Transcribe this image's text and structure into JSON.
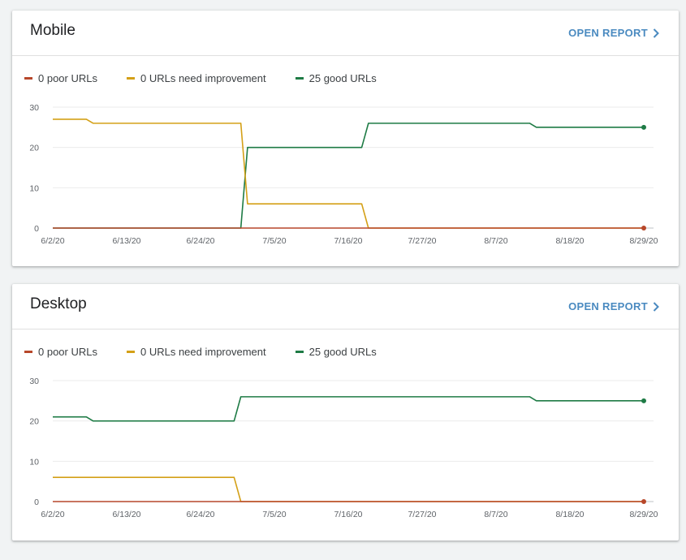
{
  "colors": {
    "poor": "#b7472a",
    "needs_improvement": "#d4a017",
    "good": "#1e7b45",
    "accent": "#4a8ac0"
  },
  "cards": [
    {
      "title": "Mobile",
      "open_report": "OPEN REPORT",
      "legend": [
        "0 poor URLs",
        "0 URLs need improvement",
        "25 good URLs"
      ]
    },
    {
      "title": "Desktop",
      "open_report": "OPEN REPORT",
      "legend": [
        "0 poor URLs",
        "0 URLs need improvement",
        "25 good URLs"
      ]
    }
  ],
  "chart_data": [
    {
      "type": "line",
      "title": "Mobile",
      "xlabel": "",
      "ylabel": "",
      "x_ticks": [
        "6/2/20",
        "6/13/20",
        "6/24/20",
        "7/5/20",
        "7/16/20",
        "7/27/20",
        "8/7/20",
        "8/18/20",
        "8/29/20"
      ],
      "y_ticks": [
        0,
        10,
        20,
        30
      ],
      "xlim": [
        "2020-06-02",
        "2020-08-29"
      ],
      "ylim": [
        0,
        30
      ],
      "grid": true,
      "legend_position": "top-left",
      "series": [
        {
          "name": "0 poor URLs",
          "color": "#b7472a",
          "points": [
            [
              "2020-06-02",
              0
            ],
            [
              "2020-08-29",
              0
            ]
          ]
        },
        {
          "name": "0 URLs need improvement",
          "color": "#d4a017",
          "points": [
            [
              "2020-06-02",
              27
            ],
            [
              "2020-06-07",
              27
            ],
            [
              "2020-06-08",
              26
            ],
            [
              "2020-06-30",
              26
            ],
            [
              "2020-07-01",
              6
            ],
            [
              "2020-07-18",
              6
            ],
            [
              "2020-07-19",
              0
            ],
            [
              "2020-08-29",
              0
            ]
          ]
        },
        {
          "name": "25 good URLs",
          "color": "#1e7b45",
          "points": [
            [
              "2020-06-02",
              0
            ],
            [
              "2020-06-30",
              0
            ],
            [
              "2020-07-01",
              20
            ],
            [
              "2020-07-18",
              20
            ],
            [
              "2020-07-19",
              26
            ],
            [
              "2020-08-12",
              26
            ],
            [
              "2020-08-13",
              25
            ],
            [
              "2020-08-29",
              25
            ]
          ]
        }
      ]
    },
    {
      "type": "line",
      "title": "Desktop",
      "xlabel": "",
      "ylabel": "",
      "x_ticks": [
        "6/2/20",
        "6/13/20",
        "6/24/20",
        "7/5/20",
        "7/16/20",
        "7/27/20",
        "8/7/20",
        "8/18/20",
        "8/29/20"
      ],
      "y_ticks": [
        0,
        10,
        20,
        30
      ],
      "xlim": [
        "2020-06-02",
        "2020-08-29"
      ],
      "ylim": [
        0,
        30
      ],
      "grid": true,
      "legend_position": "top-left",
      "series": [
        {
          "name": "0 poor URLs",
          "color": "#b7472a",
          "points": [
            [
              "2020-06-02",
              0
            ],
            [
              "2020-08-29",
              0
            ]
          ]
        },
        {
          "name": "0 URLs need improvement",
          "color": "#d4a017",
          "points": [
            [
              "2020-06-02",
              6
            ],
            [
              "2020-06-29",
              6
            ],
            [
              "2020-06-30",
              0
            ],
            [
              "2020-08-29",
              0
            ]
          ]
        },
        {
          "name": "25 good URLs",
          "color": "#1e7b45",
          "points": [
            [
              "2020-06-02",
              21
            ],
            [
              "2020-06-07",
              21
            ],
            [
              "2020-06-08",
              20
            ],
            [
              "2020-06-29",
              20
            ],
            [
              "2020-06-30",
              26
            ],
            [
              "2020-08-12",
              26
            ],
            [
              "2020-08-13",
              25
            ],
            [
              "2020-08-29",
              25
            ]
          ]
        }
      ]
    }
  ]
}
